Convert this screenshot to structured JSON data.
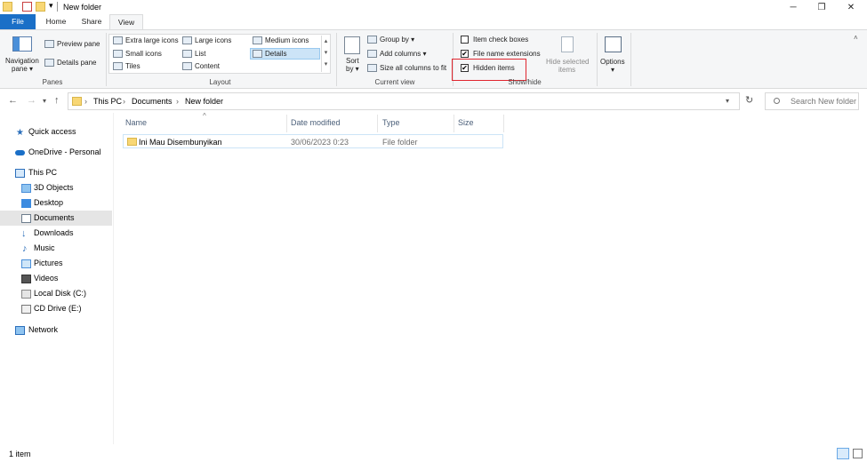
{
  "window": {
    "title": "New folder",
    "controls": {
      "minimize": "─",
      "maximize": "❐",
      "close": "✕"
    }
  },
  "tabs": {
    "file": "File",
    "home": "Home",
    "share": "Share",
    "view": "View"
  },
  "ribbon": {
    "panes": {
      "navigation_pane_line1": "Navigation",
      "navigation_pane_line2": "pane ▾",
      "preview_pane": "Preview pane",
      "details_pane": "Details pane",
      "group_label": "Panes"
    },
    "layout": {
      "extra_large_icons": "Extra large icons",
      "large_icons": "Large icons",
      "medium_icons": "Medium icons",
      "small_icons": "Small icons",
      "list": "List",
      "details": "Details",
      "tiles": "Tiles",
      "content": "Content",
      "group_label": "Layout"
    },
    "current_view": {
      "sort_by_line1": "Sort",
      "sort_by_line2": "by ▾",
      "group_by": "Group by ▾",
      "add_columns": "Add columns ▾",
      "size_all_columns": "Size all columns to fit",
      "group_label": "Current view"
    },
    "show_hide": {
      "item_check_boxes": "Item check boxes",
      "item_check_boxes_checked": "",
      "file_name_extensions": "File name extensions",
      "file_name_extensions_checked": "✔",
      "hidden_items": "Hidden items",
      "hidden_items_checked": "✔",
      "hide_selected_line1": "Hide selected",
      "hide_selected_line2": "items",
      "group_label": "Show/hide"
    },
    "options": {
      "label_line1": "Options",
      "label_line2": "▾"
    }
  },
  "address": {
    "back": "←",
    "forward": "→",
    "recent": "▾",
    "up": "↑",
    "crumbs": [
      "This PC",
      "Documents",
      "New folder"
    ],
    "separator": "›",
    "dropdown": "▾",
    "refresh": "↻",
    "search_placeholder": "Search New folder"
  },
  "nav": {
    "quick_access": "Quick access",
    "onedrive": "OneDrive - Personal",
    "this_pc": "This PC",
    "objects_3d": "3D Objects",
    "desktop": "Desktop",
    "documents": "Documents",
    "downloads": "Downloads",
    "music": "Music",
    "pictures": "Pictures",
    "videos": "Videos",
    "local_disk": "Local Disk (C:)",
    "cd_drive": "CD Drive (E:)",
    "network": "Network"
  },
  "content": {
    "columns": {
      "name": "Name",
      "date_modified": "Date modified",
      "type": "Type",
      "size": "Size",
      "sort_indicator": "^"
    },
    "files": [
      {
        "name": "Ini Mau Disembunyikan",
        "date_modified": "30/06/2023 0:23",
        "type": "File folder",
        "size": ""
      }
    ]
  },
  "status": {
    "item_count": "1 item"
  },
  "colors": {
    "accent": "#1a6fc7",
    "highlight_box": "#e0262f",
    "selection": "#cce4f7",
    "folder": "#f8d775"
  }
}
